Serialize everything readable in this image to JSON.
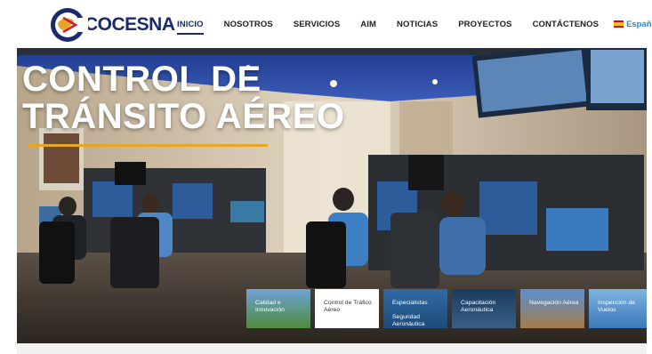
{
  "header": {
    "logo_text": "COCESNA",
    "nav": [
      {
        "label": "INICIO",
        "active": true
      },
      {
        "label": "NOSOTROS",
        "active": false
      },
      {
        "label": "SERVICIOS",
        "active": false
      },
      {
        "label": "AIM",
        "active": false
      },
      {
        "label": "NOTICIAS",
        "active": false
      },
      {
        "label": "PROYECTOS",
        "active": false
      },
      {
        "label": "CONTÁCTENOS",
        "active": false
      }
    ],
    "language": "Español"
  },
  "hero": {
    "title_line1": "CONTROL DE",
    "title_line2": "TRÁNSITO AÉREO",
    "accent_color": "#e7a623",
    "thumbnails": [
      {
        "label": "Calidad e Innovación"
      },
      {
        "label": "Control de Tráfico Aéreo",
        "selected": true
      },
      {
        "label": "Especialistas",
        "label2": "Seguridad Aeronáutica"
      },
      {
        "label": "Capacitación Aeronáutica"
      },
      {
        "label": "Navegación Aérea"
      },
      {
        "label": "Inspección de Vuelos"
      }
    ]
  },
  "colors": {
    "brand": "#1b2a6b",
    "link": "#1e90d6"
  }
}
